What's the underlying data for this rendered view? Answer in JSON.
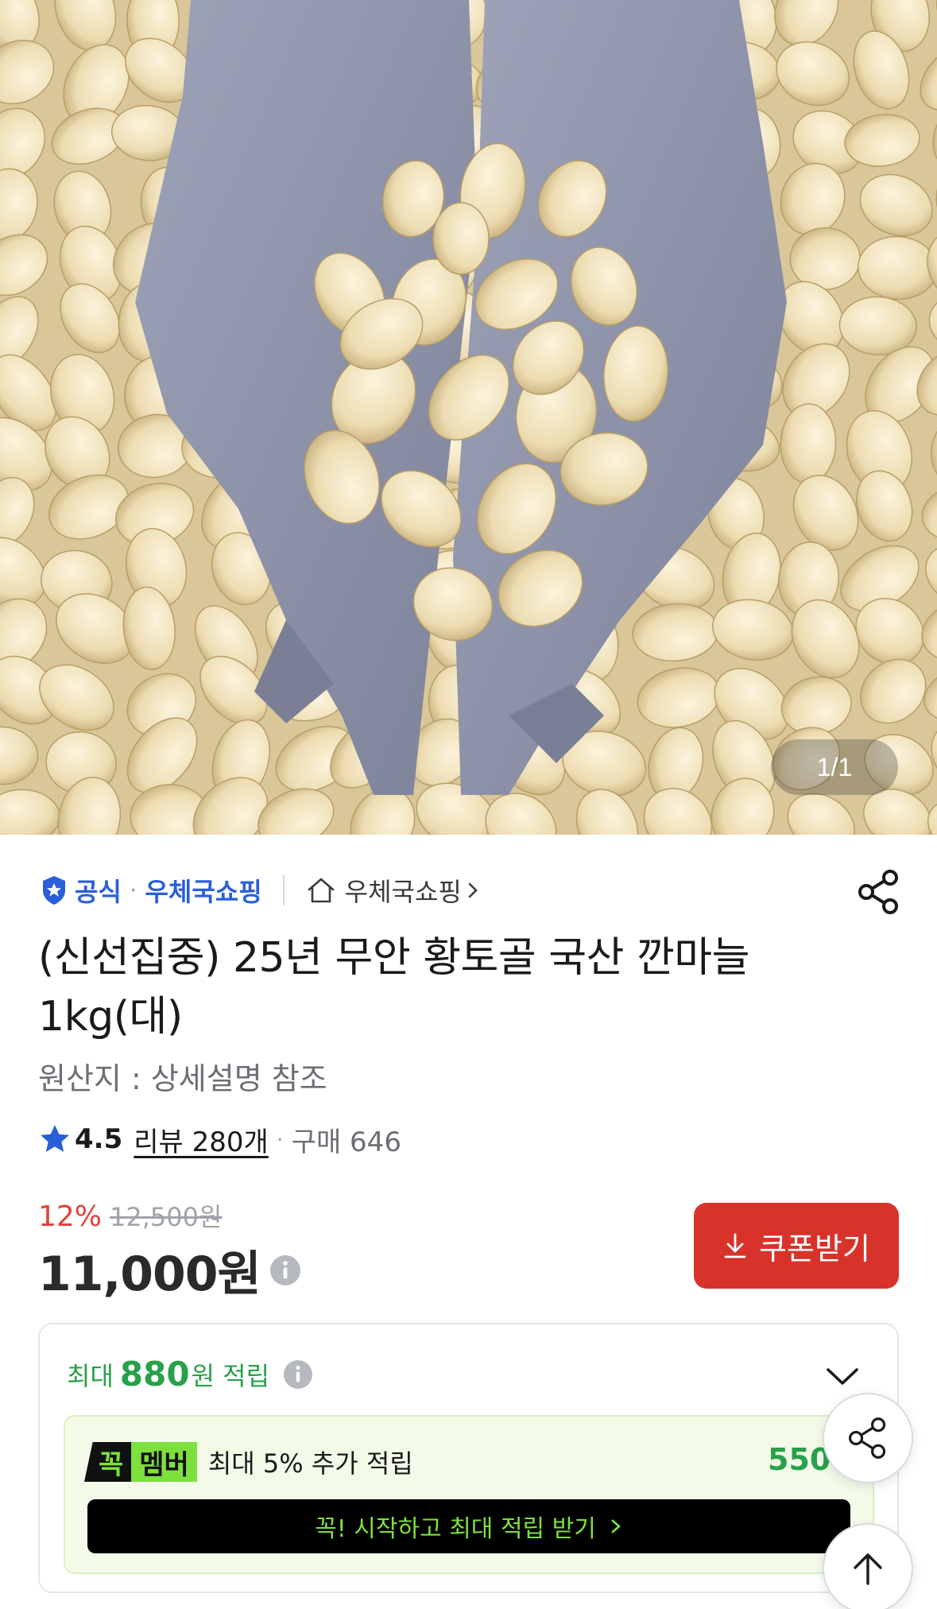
{
  "gallery": {
    "image_alt": "gloved hands holding peeled garlic cloves",
    "counter": "1/1"
  },
  "seller": {
    "official_label": "공식",
    "dot": "·",
    "name": "우체국쇼핑",
    "store_link": "우체국쇼핑"
  },
  "product": {
    "title": "(신선집중) 25년 무안 황토골 국산 깐마늘 1kg(대)",
    "origin": "원산지 : 상세설명 참조"
  },
  "rating": {
    "score": "4.5",
    "reviews": "리뷰 280개",
    "separator": "·",
    "purchases": "구매 646"
  },
  "price": {
    "discount": "12%",
    "original": "12,500원",
    "current": "11,000원"
  },
  "coupon": {
    "label": "쿠폰받기"
  },
  "reward": {
    "prefix": "최대",
    "amount": "880",
    "unit": "원 적립",
    "member_badge_k": "꼭",
    "member_badge_m": "멤버",
    "member_text": "최대 5% 추가 적립",
    "member_amount": "550",
    "cta": "꼭! 시작하고 최대 적립 받기"
  },
  "icons": {
    "official": "shield-check-icon",
    "home": "home-icon",
    "share": "share-icon",
    "star": "star-icon",
    "info": "info-icon",
    "download": "download-icon",
    "chevron_down": "chevron-down-icon",
    "arrow_up": "arrow-up-icon"
  },
  "colors": {
    "official_blue": "#2b5fd9",
    "discount_red": "#e0423a",
    "coupon_red": "#d8332b",
    "reward_green": "#27a14a",
    "member_lime": "#7ee03c"
  }
}
